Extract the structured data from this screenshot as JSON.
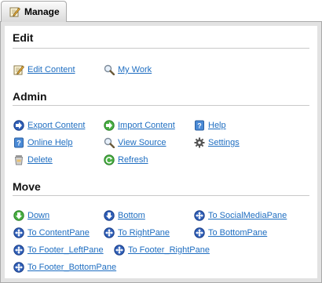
{
  "manage": {
    "label": "Manage"
  },
  "sections": {
    "edit": {
      "title": "Edit",
      "items": [
        {
          "label": "Edit Content",
          "icon": "edit-pencil-icon"
        },
        {
          "label": "My Work",
          "icon": "magnifier-icon"
        }
      ]
    },
    "admin": {
      "title": "Admin",
      "items": [
        {
          "label": "Export Content",
          "icon": "export-globe-icon"
        },
        {
          "label": "Import Content",
          "icon": "import-arrow-icon"
        },
        {
          "label": "Help",
          "icon": "help-book-icon"
        },
        {
          "label": "Online Help",
          "icon": "help-book-icon"
        },
        {
          "label": "View Source",
          "icon": "magnifier-icon"
        },
        {
          "label": "Settings",
          "icon": "gear-icon"
        },
        {
          "label": "Delete",
          "icon": "trash-icon"
        },
        {
          "label": "Refresh",
          "icon": "refresh-icon"
        }
      ]
    },
    "move": {
      "title": "Move",
      "items": [
        {
          "label": "Down",
          "icon": "green-down-arrow-icon"
        },
        {
          "label": "Bottom",
          "icon": "blue-down-arrow-icon"
        },
        {
          "label": "To SocialMediaPane",
          "icon": "blue-move-icon"
        },
        {
          "label": "To ContentPane",
          "icon": "blue-move-icon"
        },
        {
          "label": "To RightPane",
          "icon": "blue-move-icon"
        },
        {
          "label": "To BottomPane",
          "icon": "blue-move-icon"
        },
        {
          "label": "To Footer_LeftPane",
          "icon": "blue-move-icon"
        },
        {
          "label": "To Footer_RightPane",
          "icon": "blue-move-icon"
        },
        {
          "label": "To Footer_BottomPane",
          "icon": "blue-move-icon"
        }
      ]
    }
  },
  "colors": {
    "link": "#1f6ec1",
    "panel_bg": "#e2e2e2",
    "rule": "#c9c9c9"
  }
}
